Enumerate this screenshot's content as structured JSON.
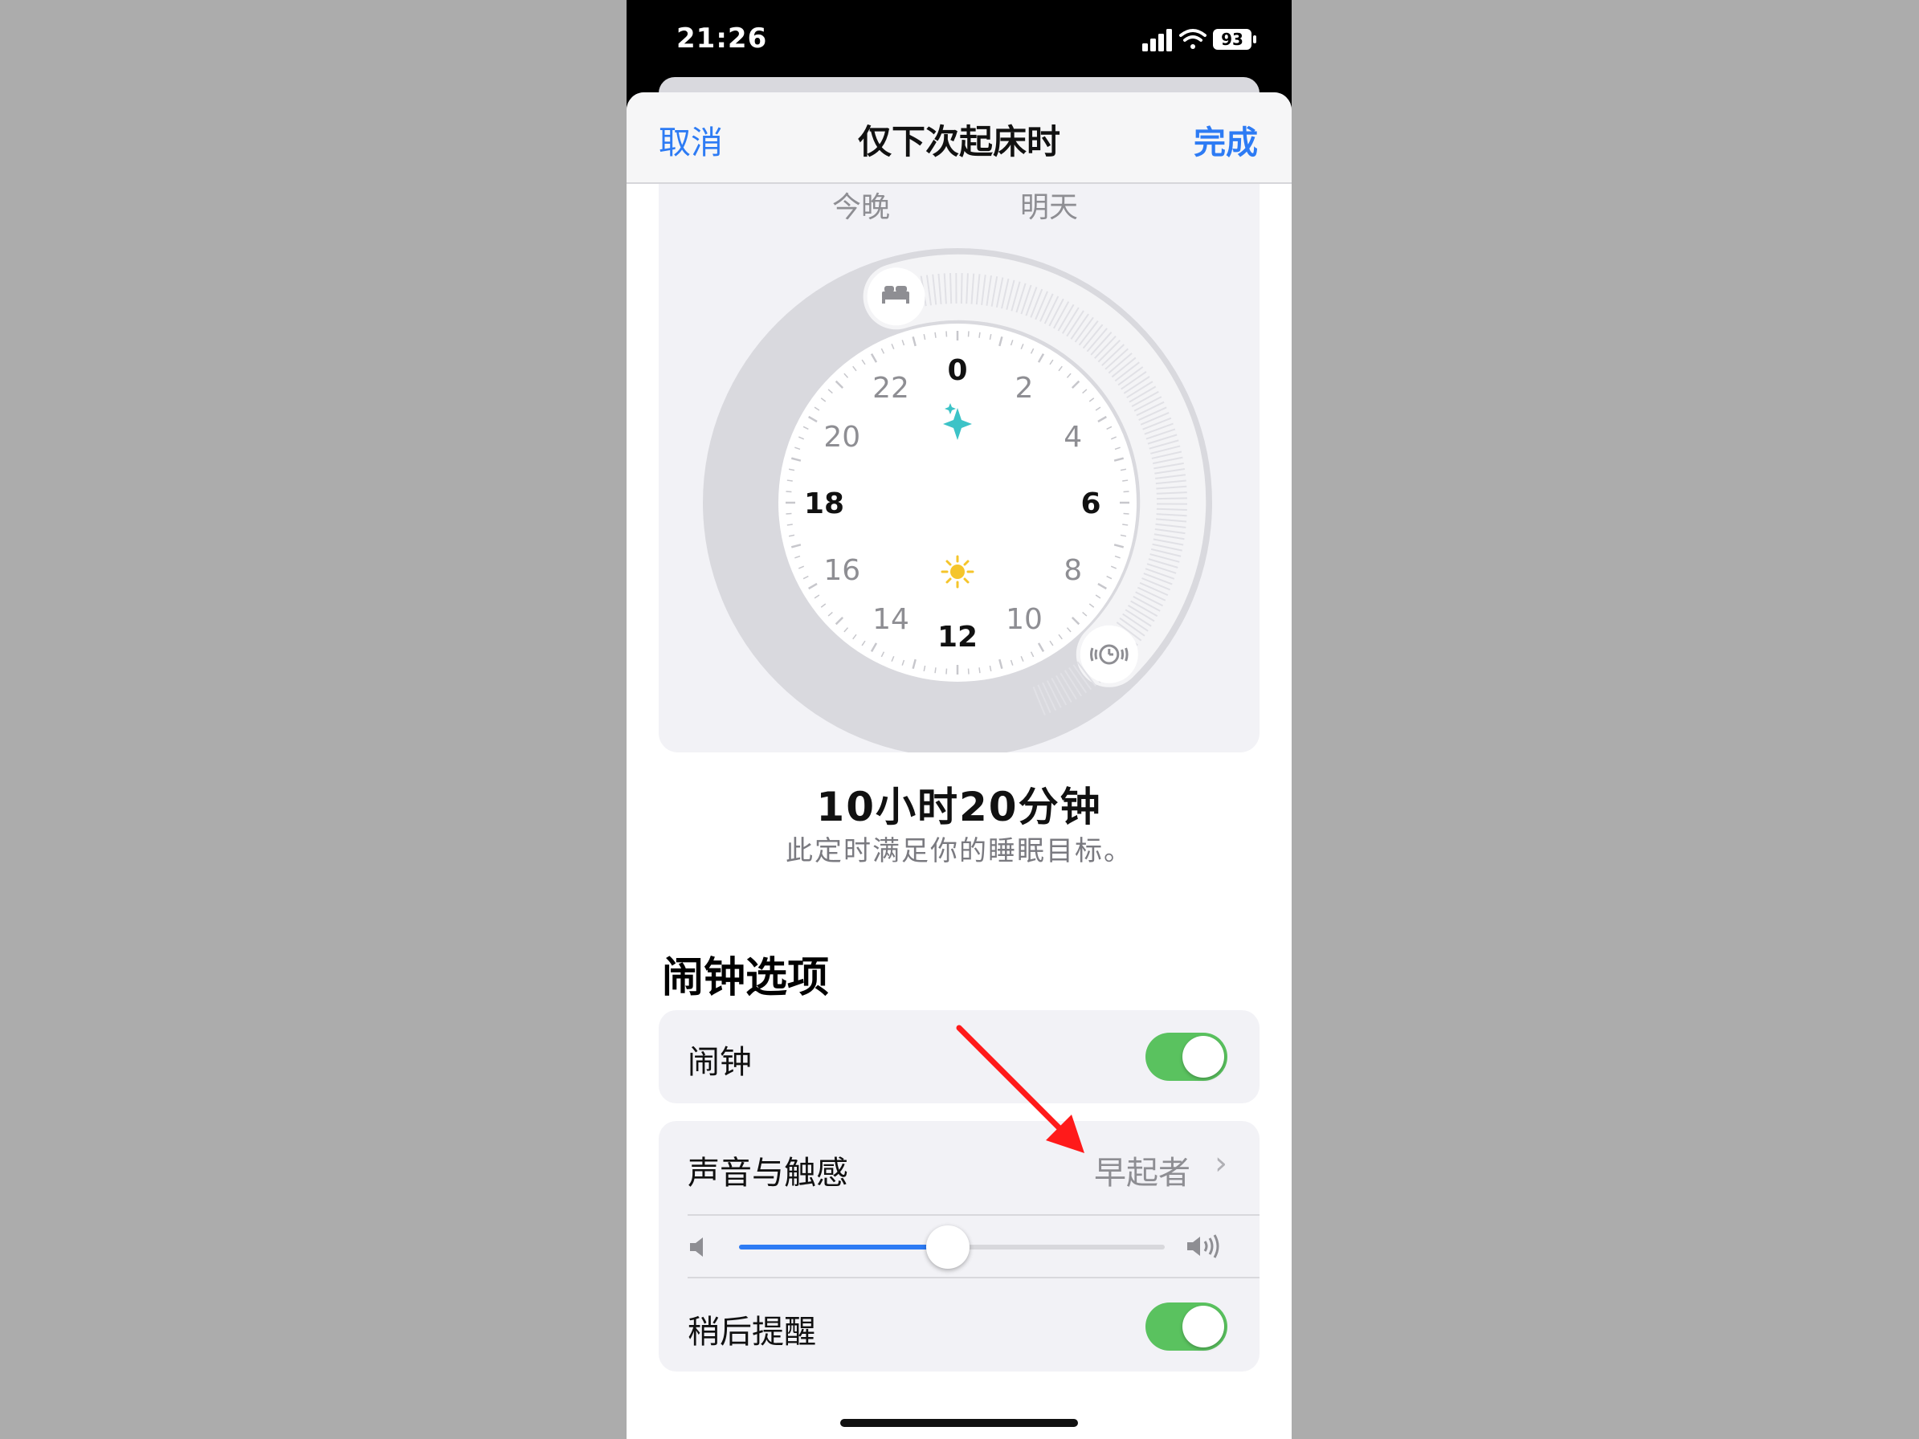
{
  "status": {
    "time": "21:26",
    "battery": "93"
  },
  "nav": {
    "cancel": "取消",
    "title": "仅下次起床时",
    "done": "完成"
  },
  "clock": {
    "day_left": "今晚",
    "day_right": "明天",
    "hours": [
      "0",
      "2",
      "4",
      "6",
      "8",
      "10",
      "12",
      "14",
      "16",
      "18",
      "20",
      "22"
    ],
    "duration": "10小时20分钟",
    "duration_note": "此定时满足你的睡眠目标。"
  },
  "alarm_options": {
    "section_title": "闹钟选项",
    "alarm_label": "闹钟",
    "alarm_on": true,
    "sound_label": "声音与触感",
    "sound_value": "早起者",
    "volume": 0.49,
    "snooze_label": "稍后提醒",
    "snooze_on": true
  },
  "colors": {
    "accent_blue": "#2d7bf4",
    "toggle_green": "#5ac25f",
    "annotation_red": "#ff1a1a"
  }
}
